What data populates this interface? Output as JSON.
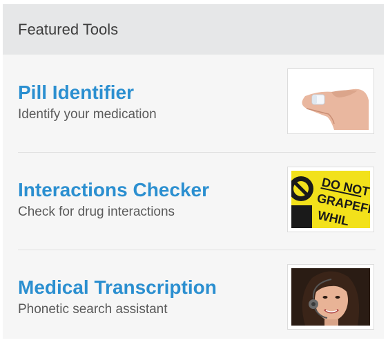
{
  "panel": {
    "title": "Featured Tools"
  },
  "tools": [
    {
      "name": "Pill Identifier",
      "description": "Identify your medication",
      "image_icon": "pill-in-fingers-image"
    },
    {
      "name": "Interactions Checker",
      "description": "Check for drug interactions",
      "image_icon": "warning-label-image",
      "image_text": [
        "DO NOT",
        "GRAPEFR",
        "WHIL"
      ]
    },
    {
      "name": "Medical Transcription",
      "description": "Phonetic search assistant",
      "image_icon": "headset-operator-image"
    }
  ],
  "colors": {
    "link": "#2b8fd0",
    "header_bg": "#e6e7e8",
    "panel_bg": "#f6f6f6",
    "label_yellow": "#f2e11b"
  }
}
